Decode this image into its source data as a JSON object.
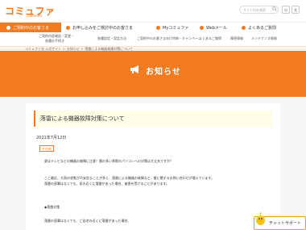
{
  "header": {
    "logo": "コミュファ",
    "logo_sub": "commufa",
    "search_placeholder": "サイト内を検索",
    "font_small": "小",
    "font_large": "大"
  },
  "main_nav": [
    {
      "label": "ご契約中のお客さま"
    },
    {
      "label": "お申し込みをご検討中のお客さま"
    },
    {
      "label": "Myコミュファ"
    },
    {
      "label": "Webメール"
    },
    {
      "label": "よくあるご質問"
    }
  ],
  "sub_nav": [
    {
      "line1": "ご契約内容確認・変更・",
      "line2": "各種お手続き"
    },
    {
      "line1": "各種設定・設定方法",
      "line2": ""
    },
    {
      "line1": "ご契約中のお客さま向け特典・キャンペーン",
      "line2": ""
    },
    {
      "line1": "よくあるご質問",
      "line2": ""
    },
    {
      "line1": "障害情報",
      "line2": ""
    },
    {
      "line1": "メンテナンス情報",
      "line2": ""
    }
  ],
  "breadcrumb": "コミュファ光 公式サイト ＞ お知らせ ＞ 落雷による機器故障対策について",
  "banner": {
    "title": "お知らせ"
  },
  "article": {
    "title": "落雷による機器故障対策について",
    "date": "2021年7月12日",
    "badge": "その他",
    "paragraphs": [
      "夏はテレビなどの機器の故障に注意！雷の多い季節のパソコンへの対策は大丈夫ですか？",
      "ここ最近、大雨の状態が不安定なことが多く、落雷による機器の故障など、雷に関するお問い合わせが増えています。",
      "落雷の直撃はなくても、家の近くに落雷があった場合、被害を受けることがあります。",
      "◆落雷対策",
      "落雷の直撃はなくても、ご自宅の近くに落雷があった場合、"
    ]
  },
  "support": {
    "label": "チャットサポート"
  },
  "colors": {
    "brand": "#f27a1f",
    "title_bg": "#fffce8"
  }
}
